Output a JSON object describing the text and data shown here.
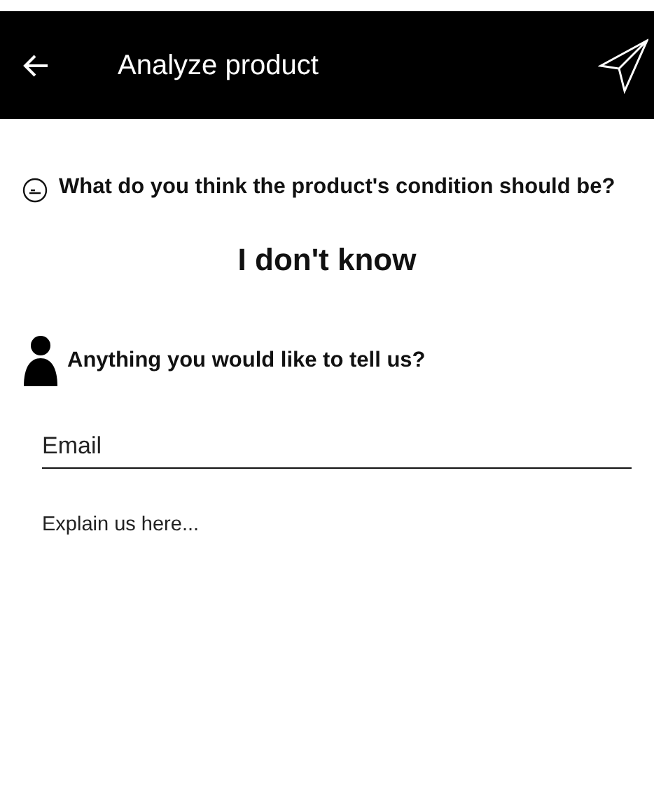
{
  "app_bar": {
    "title": "Analyze product"
  },
  "condition": {
    "question": "What do you think the product's condition should be?",
    "answer": "I don't know"
  },
  "feedback": {
    "question": "Anything you would like to tell us?",
    "email": {
      "placeholder": "Email"
    },
    "message": {
      "placeholder": "Explain us here..."
    }
  }
}
